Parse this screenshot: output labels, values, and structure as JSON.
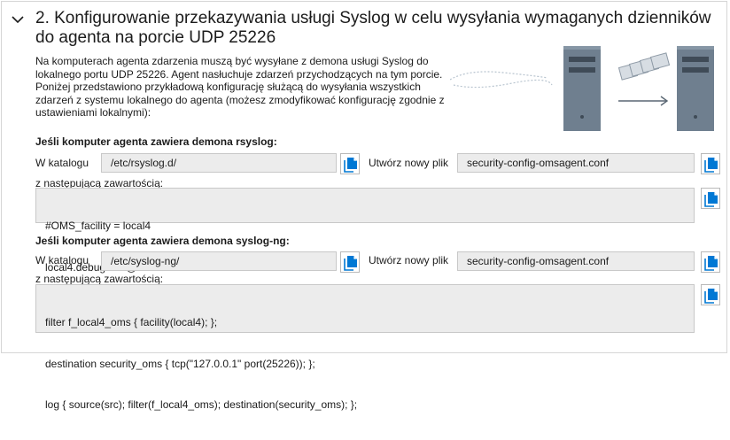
{
  "header": {
    "title": "2. Konfigurowanie przekazywania usługi Syslog w celu wysyłania wymaganych dzienników do agenta na porcie UDP 25226"
  },
  "description": {
    "lines": [
      "Na komputerach agenta zdarzenia muszą być wysyłane z demona usługi Syslog do",
      "lokalnego portu UDP 25226. Agent nasłuchuje zdarzeń przychodzących na tym porcie.",
      "Poniżej przedstawiono przykładową konfigurację służącą do wysyłania wszystkich",
      "zdarzeń z systemu lokalnego do agenta (możesz zmodyfikować konfigurację zgodnie z",
      "ustawieniami lokalnymi):"
    ]
  },
  "rsyslog": {
    "heading": "Jeśli komputer agenta zawiera demona rsyslog:",
    "dir_label": "W katalogu",
    "dir_value": "/etc/rsyslog.d/",
    "file_label": "Utwórz nowy plik",
    "file_value": "security-config-omsagent.conf",
    "content_label": "z następującą zawartością:",
    "content_lines": [
      "#OMS_facility = local4",
      "local4.debug       @127.0.0.1:25226"
    ]
  },
  "syslogng": {
    "heading": "Jeśli komputer agenta zawiera demona syslog-ng:",
    "dir_label": "W katalogu",
    "dir_value": "/etc/syslog-ng/",
    "file_label": "Utwórz nowy plik",
    "file_value": "security-config-omsagent.conf",
    "content_label": "z następującą zawartością:",
    "content_lines": [
      "filter f_local4_oms { facility(local4); };",
      "destination security_oms { tcp(\"127.0.0.1\" port(25226)); };",
      "log { source(src); filter(f_local4_oms); destination(security_oms); };"
    ]
  },
  "icons": {
    "collapse": "chevron-down-icon",
    "copy": "copy-icon",
    "illustration": "server-forwarding-illustration"
  },
  "colors": {
    "accent": "#0078d4",
    "field_bg": "#ececec",
    "server_body": "#6f7f8f"
  }
}
